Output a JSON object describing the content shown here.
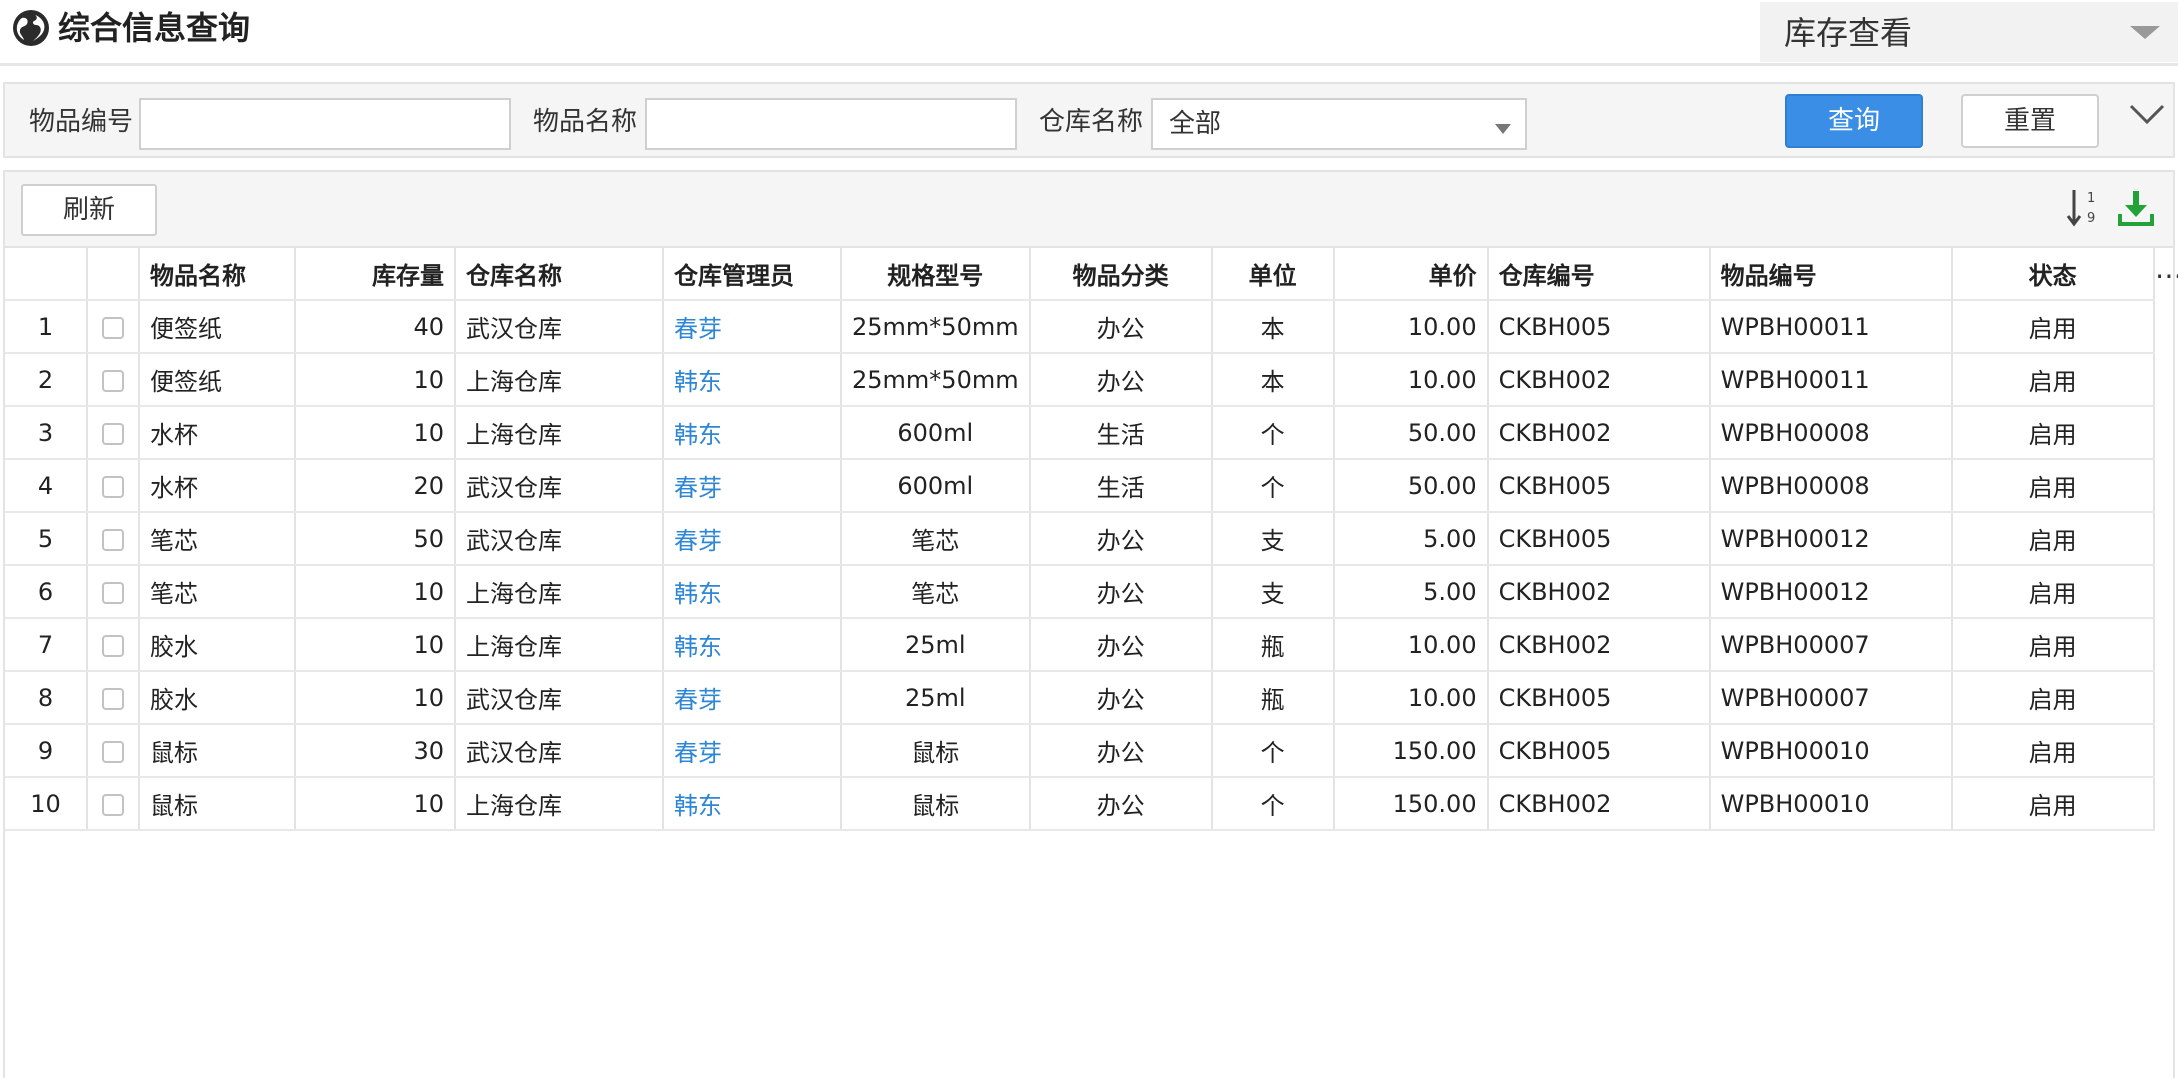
{
  "header": {
    "title": "综合信息查询",
    "view_select": "库存查看"
  },
  "filters": {
    "item_code_label": "物品编号",
    "item_code_value": "",
    "item_name_label": "物品名称",
    "item_name_value": "",
    "warehouse_label": "仓库名称",
    "warehouse_value": "全部",
    "query_button": "查询",
    "reset_button": "重置"
  },
  "toolbar": {
    "refresh_button": "刷新"
  },
  "table": {
    "headers": [
      "物品名称",
      "库存量",
      "仓库名称",
      "仓库管理员",
      "规格型号",
      "物品分类",
      "单位",
      "单价",
      "仓库编号",
      "物品编号",
      "状态"
    ],
    "rows": [
      {
        "no": "1",
        "name": "便签纸",
        "qty": "40",
        "warehouse": "武汉仓库",
        "manager": "春芽",
        "spec": "25mm*50mm",
        "category": "办公",
        "unit": "本",
        "price": "10.00",
        "wh_code": "CKBH005",
        "item_code": "WPBH00011",
        "status": "启用"
      },
      {
        "no": "2",
        "name": "便签纸",
        "qty": "10",
        "warehouse": "上海仓库",
        "manager": "韩东",
        "spec": "25mm*50mm",
        "category": "办公",
        "unit": "本",
        "price": "10.00",
        "wh_code": "CKBH002",
        "item_code": "WPBH00011",
        "status": "启用"
      },
      {
        "no": "3",
        "name": "水杯",
        "qty": "10",
        "warehouse": "上海仓库",
        "manager": "韩东",
        "spec": "600ml",
        "category": "生活",
        "unit": "个",
        "price": "50.00",
        "wh_code": "CKBH002",
        "item_code": "WPBH00008",
        "status": "启用"
      },
      {
        "no": "4",
        "name": "水杯",
        "qty": "20",
        "warehouse": "武汉仓库",
        "manager": "春芽",
        "spec": "600ml",
        "category": "生活",
        "unit": "个",
        "price": "50.00",
        "wh_code": "CKBH005",
        "item_code": "WPBH00008",
        "status": "启用"
      },
      {
        "no": "5",
        "name": "笔芯",
        "qty": "50",
        "warehouse": "武汉仓库",
        "manager": "春芽",
        "spec": "笔芯",
        "category": "办公",
        "unit": "支",
        "price": "5.00",
        "wh_code": "CKBH005",
        "item_code": "WPBH00012",
        "status": "启用"
      },
      {
        "no": "6",
        "name": "笔芯",
        "qty": "10",
        "warehouse": "上海仓库",
        "manager": "韩东",
        "spec": "笔芯",
        "category": "办公",
        "unit": "支",
        "price": "5.00",
        "wh_code": "CKBH002",
        "item_code": "WPBH00012",
        "status": "启用"
      },
      {
        "no": "7",
        "name": "胶水",
        "qty": "10",
        "warehouse": "上海仓库",
        "manager": "韩东",
        "spec": "25ml",
        "category": "办公",
        "unit": "瓶",
        "price": "10.00",
        "wh_code": "CKBH002",
        "item_code": "WPBH00007",
        "status": "启用"
      },
      {
        "no": "8",
        "name": "胶水",
        "qty": "10",
        "warehouse": "武汉仓库",
        "manager": "春芽",
        "spec": "25ml",
        "category": "办公",
        "unit": "瓶",
        "price": "10.00",
        "wh_code": "CKBH005",
        "item_code": "WPBH00007",
        "status": "启用"
      },
      {
        "no": "9",
        "name": "鼠标",
        "qty": "30",
        "warehouse": "武汉仓库",
        "manager": "春芽",
        "spec": "鼠标",
        "category": "办公",
        "unit": "个",
        "price": "150.00",
        "wh_code": "CKBH005",
        "item_code": "WPBH00010",
        "status": "启用"
      },
      {
        "no": "10",
        "name": "鼠标",
        "qty": "10",
        "warehouse": "上海仓库",
        "manager": "韩东",
        "spec": "鼠标",
        "category": "办公",
        "unit": "个",
        "price": "150.00",
        "wh_code": "CKBH002",
        "item_code": "WPBH00010",
        "status": "启用"
      }
    ]
  },
  "colors": {
    "accent": "#3a8ee6",
    "link": "#2d86d6",
    "download_icon": "#22a33a"
  },
  "icons": {
    "title_icon": "globe-icon",
    "view_caret": "chevron-down-icon",
    "expand": "chevron-down-icon",
    "sort": "sort-numeric-icon",
    "export": "download-icon",
    "more": "more-horizontal-icon"
  }
}
